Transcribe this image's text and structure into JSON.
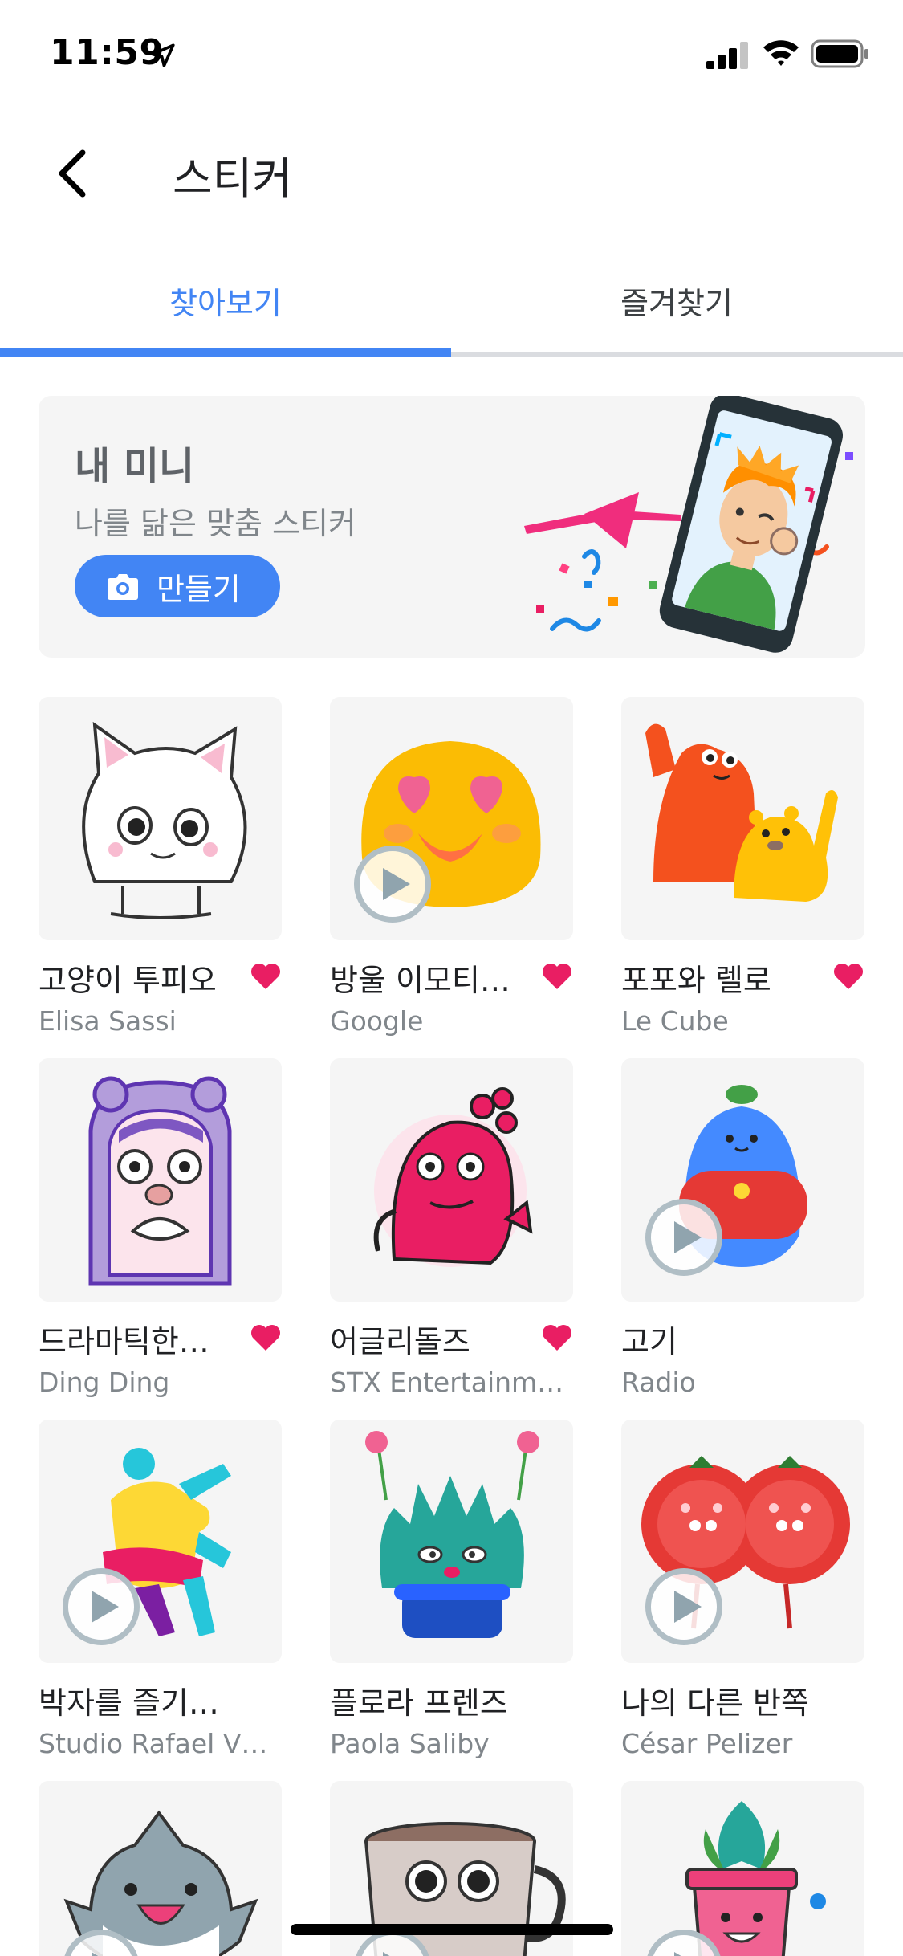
{
  "status_bar": {
    "time": "11:59"
  },
  "app_bar": {
    "title": "스티커"
  },
  "tabs": [
    {
      "label": "찾아보기",
      "active": true
    },
    {
      "label": "즐겨찾기",
      "active": false
    }
  ],
  "colors": {
    "accent": "#4285f4",
    "favorite": "#e91e63",
    "card_bg": "#f5f5f5"
  },
  "promo": {
    "title": "내 미니",
    "subtitle": "나를 닮은 맞춤 스티커",
    "button_label": "만들기",
    "button_icon": "camera-icon"
  },
  "stickers": [
    {
      "name": "고양이 투피오",
      "author": "Elisa Sassi",
      "favorite": true,
      "animated": false
    },
    {
      "name": "방울 이모티…",
      "author": "Google",
      "favorite": true,
      "animated": true
    },
    {
      "name": "포포와 렐로",
      "author": "Le Cube",
      "favorite": true,
      "animated": false
    },
    {
      "name": "드라마틱한…",
      "author": "Ding Ding",
      "favorite": true,
      "animated": false
    },
    {
      "name": "어글리돌즈",
      "author": "STX Entertainm…",
      "favorite": true,
      "animated": false
    },
    {
      "name": "고기",
      "author": "Radio",
      "favorite": false,
      "animated": true
    },
    {
      "name": "박자를 즐기…",
      "author": "Studio Rafael V…",
      "favorite": false,
      "animated": true
    },
    {
      "name": "플로라 프렌즈",
      "author": "Paola Saliby",
      "favorite": false,
      "animated": false
    },
    {
      "name": "나의 다른 반쪽",
      "author": "César Pelizer",
      "favorite": false,
      "animated": true
    },
    {
      "name": "",
      "author": "",
      "favorite": false,
      "animated": true
    },
    {
      "name": "",
      "author": "",
      "favorite": false,
      "animated": true
    },
    {
      "name": "",
      "author": "",
      "favorite": false,
      "animated": true
    }
  ]
}
